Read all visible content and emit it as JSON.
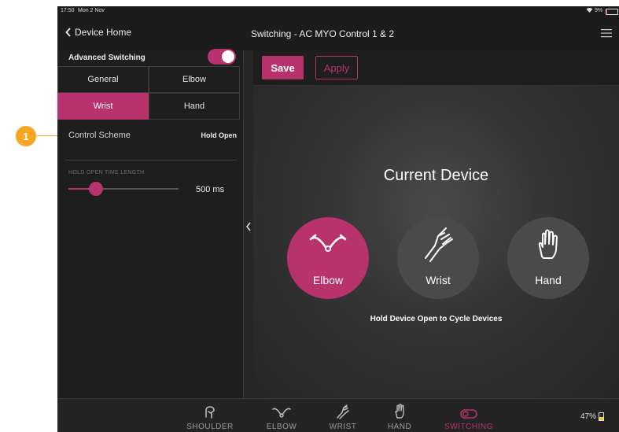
{
  "callout": {
    "number": "1",
    "color": "#f5a623"
  },
  "status": {
    "time": "17:50",
    "date": "Mon 2 Nov",
    "battery": "9%"
  },
  "nav": {
    "back_label": "Device Home",
    "title": "Switching - AC MYO Control 1 & 2"
  },
  "sidebar": {
    "advanced_label": "Advanced Switching",
    "advanced_on": true,
    "tabs": [
      {
        "label": "General",
        "active": false
      },
      {
        "label": "Elbow",
        "active": false
      },
      {
        "label": "Wrist",
        "active": true
      },
      {
        "label": "Hand",
        "active": false
      }
    ],
    "control_scheme_label": "Control Scheme",
    "control_scheme_value": "Hold Open",
    "hold_label": "HOLD OPEN TIME LENGTH",
    "hold_value": "500 ms",
    "hold_fraction": 0.25
  },
  "toolbar": {
    "save_label": "Save",
    "apply_label": "Apply"
  },
  "main": {
    "heading": "Current Device",
    "devices": [
      {
        "label": "Elbow",
        "icon": "elbow-icon",
        "active": true
      },
      {
        "label": "Wrist",
        "icon": "wrist-icon",
        "active": false
      },
      {
        "label": "Hand",
        "icon": "hand-icon",
        "active": false
      }
    ],
    "hint": "Hold Device Open to Cycle Devices"
  },
  "bottom": {
    "tabs": [
      {
        "label": "SHOULDER",
        "icon": "shoulder-icon",
        "active": false
      },
      {
        "label": "ELBOW",
        "icon": "elbow-icon",
        "active": false
      },
      {
        "label": "WRIST",
        "icon": "wrist-icon",
        "active": false
      },
      {
        "label": "HAND",
        "icon": "hand-icon",
        "active": false
      },
      {
        "label": "SWITCHING",
        "icon": "toggle-icon",
        "active": true
      }
    ],
    "battery": "47%"
  },
  "colors": {
    "accent": "#b8326e",
    "callout": "#f5a623"
  }
}
